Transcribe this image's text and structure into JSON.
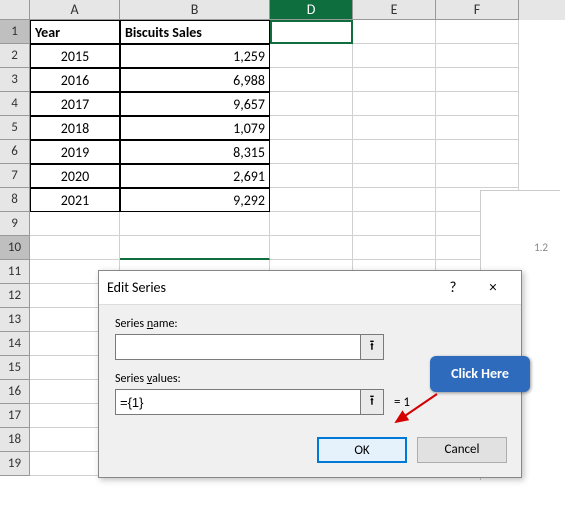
{
  "columns": {
    "A": "A",
    "B": "B",
    "D": "D",
    "E": "E",
    "F": "F"
  },
  "rows": [
    "1",
    "2",
    "3",
    "4",
    "5",
    "6",
    "7",
    "8",
    "9",
    "10",
    "11",
    "12",
    "13",
    "14",
    "15",
    "16",
    "17",
    "18",
    "19"
  ],
  "table": {
    "headers": {
      "A": "Year",
      "B": "Biscuits Sales"
    },
    "data": [
      {
        "A": "2015",
        "B": "1,259"
      },
      {
        "A": "2016",
        "B": "6,988"
      },
      {
        "A": "2017",
        "B": "9,657"
      },
      {
        "A": "2018",
        "B": "1,079"
      },
      {
        "A": "2019",
        "B": "8,315"
      },
      {
        "A": "2020",
        "B": "2,691"
      },
      {
        "A": "2021",
        "B": "9,292"
      }
    ]
  },
  "dialog": {
    "title": "Edit Series",
    "help": "?",
    "close": "×",
    "name_label_pre": "Series ",
    "name_label_u": "n",
    "name_label_post": "ame:",
    "name_value": "",
    "values_label_pre": "Series ",
    "values_label_u": "v",
    "values_label_post": "alues:",
    "values_value": "={1}",
    "values_result": "= 1",
    "ok": "OK",
    "cancel": "Cancel"
  },
  "chart": {
    "tick1": "1.2"
  },
  "annotation": {
    "text": "Click Here"
  },
  "icons": {
    "ref": "⭱"
  }
}
